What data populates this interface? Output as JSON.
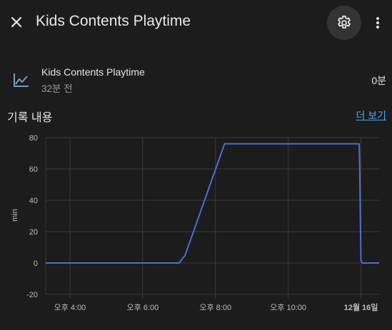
{
  "header": {
    "title": "Kids Contents Playtime"
  },
  "icons": {
    "close": "close-icon",
    "settings": "gear-icon",
    "more": "more-vertical-icon",
    "entity": "chart-line-icon"
  },
  "entity": {
    "name": "Kids Contents Playtime",
    "last_changed": "32분 전",
    "state": "0분"
  },
  "history": {
    "title": "기록 내용",
    "more_label": "더 보기"
  },
  "colors": {
    "line": "#4a6fd1",
    "link": "#3fa9f5",
    "background": "#1c1c1c"
  },
  "chart_data": {
    "type": "line",
    "ylabel": "min",
    "ylim": [
      -20,
      80
    ],
    "yticks": [
      80,
      60,
      40,
      20,
      0,
      -20
    ],
    "xticks": [
      "오후 4:00",
      "오후 6:00",
      "오후 8:00",
      "오후 10:00",
      "12월 16일"
    ],
    "x_time_range": [
      "15:20",
      "00:30"
    ],
    "series": [
      {
        "values": [
          {
            "x": "15:20",
            "y": 0
          },
          {
            "x": "19:00",
            "y": 0
          },
          {
            "x": "19:10",
            "y": 5
          },
          {
            "x": "20:15",
            "y": 76
          },
          {
            "x": "20:20",
            "y": 76
          },
          {
            "x": "23:57",
            "y": 76
          },
          {
            "x": "23:58",
            "y": 60
          },
          {
            "x": "00:00",
            "y": 2
          },
          {
            "x": "00:02",
            "y": 0
          },
          {
            "x": "00:30",
            "y": 0
          }
        ]
      }
    ]
  }
}
